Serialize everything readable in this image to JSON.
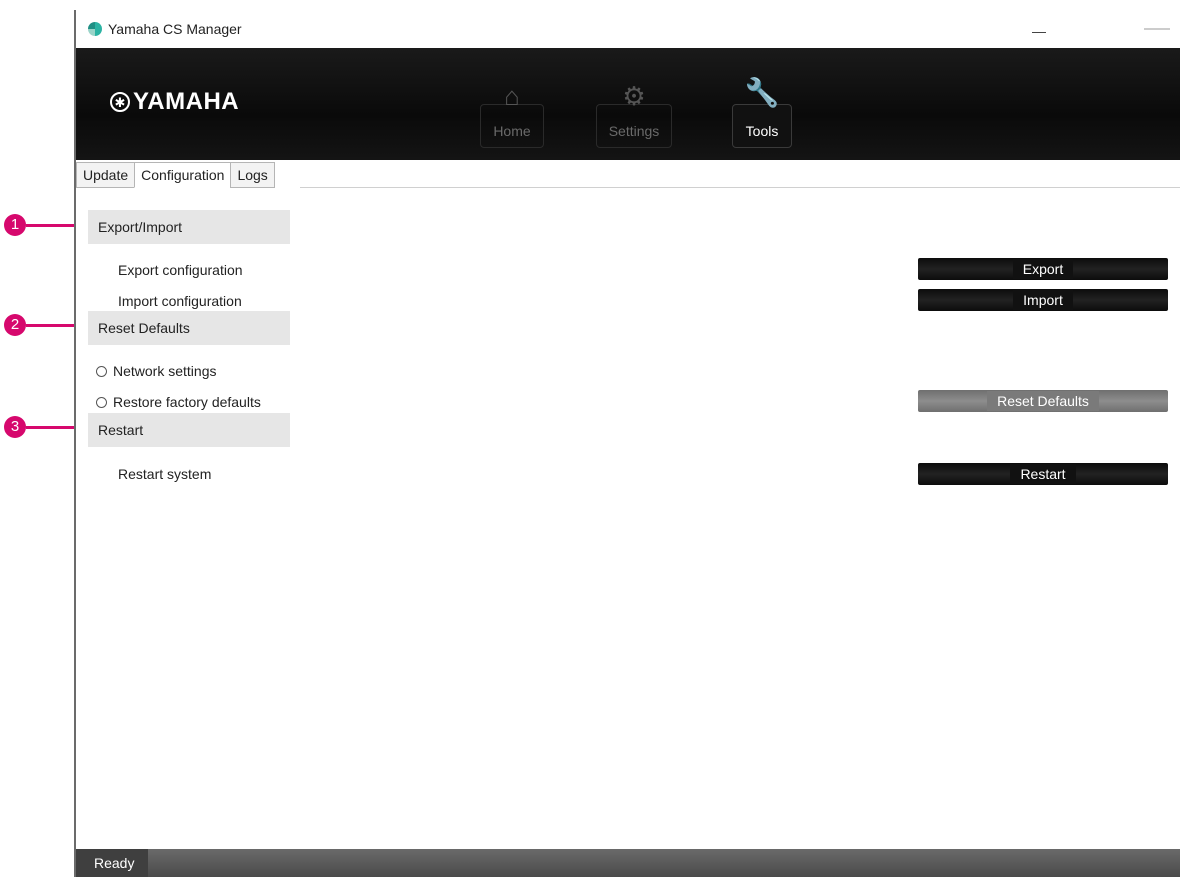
{
  "window": {
    "title": "Yamaha CS Manager"
  },
  "header": {
    "logo_text": "YAMAHA",
    "nav": [
      {
        "label": "Home",
        "icon": "home-icon",
        "active": false
      },
      {
        "label": "Settings",
        "icon": "gear-icon",
        "active": false
      },
      {
        "label": "Tools",
        "icon": "wrench-icon",
        "active": true
      }
    ]
  },
  "tabs": [
    {
      "label": "Update",
      "active": false
    },
    {
      "label": "Configuration",
      "active": true
    },
    {
      "label": "Logs",
      "active": false
    }
  ],
  "sections": {
    "export_import": {
      "title": "Export/Import",
      "export_label": "Export configuration",
      "export_button": "Export",
      "import_label": "Import configuration",
      "import_button": "Import"
    },
    "reset_defaults": {
      "title": "Reset Defaults",
      "option_network": "Network settings",
      "option_factory": "Restore factory defaults",
      "reset_button": "Reset Defaults"
    },
    "restart": {
      "title": "Restart",
      "restart_label": "Restart system",
      "restart_button": "Restart"
    }
  },
  "status": {
    "text": "Ready"
  },
  "callouts": [
    "1",
    "2",
    "3"
  ],
  "colors": {
    "callout": "#d6086d",
    "header_bg": "#0a0a0a"
  }
}
